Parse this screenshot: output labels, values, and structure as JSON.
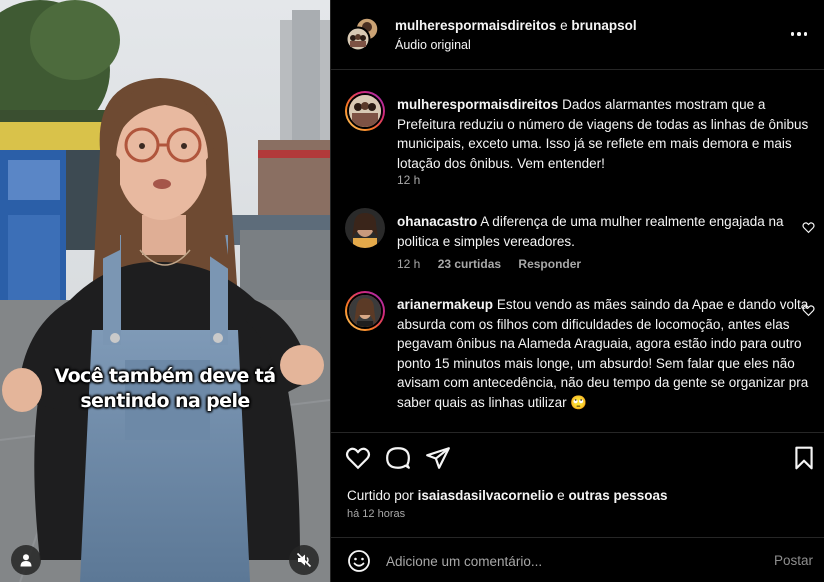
{
  "video": {
    "overlay_lines": [
      "Você também deve tá",
      "sentindo na pele"
    ],
    "icons": {
      "user": "user-icon",
      "mute": "muted-speaker-icon"
    }
  },
  "header": {
    "user1": "mulherespormaisdireitos",
    "conjunction": "e",
    "user2": "brunapsol",
    "audio": "Áudio original"
  },
  "caption": {
    "username": "mulherespormaisdireitos",
    "text": "Dados alarmantes mostram que a Prefeitura reduziu o número de viagens de todas as linhas de ônibus municipais, exceto uma. Isso já se reflete em mais demora e mais lotação dos ônibus. Vem entender!",
    "time": "12 h"
  },
  "comments": [
    {
      "username": "ohanacastro",
      "text": "A diferença de uma mulher realmente engajada na politica e simples vereadores.",
      "time": "12 h",
      "likes": "23 curtidas",
      "reply": "Responder"
    },
    {
      "username": "arianermakeup",
      "text": "Estou vendo as mães saindo da Apae e dando volta absurda com os filhos com dificuldades de locomoção, antes elas pegavam ônibus na Alameda Araguaia, agora estão indo para outro ponto 15 minutos mais longe, um absurdo! Sem falar que eles não avisam com antecedência, não deu tempo da gente se organizar pra saber quais as linhas utilizar",
      "emoji": "🙄"
    }
  ],
  "actions": {
    "liked_prefix": "Curtido por",
    "liked_user": "isaiasdasilvacornelio",
    "liked_and": "e",
    "liked_others": "outras pessoas",
    "timestamp": "há 12 horas"
  },
  "add_comment": {
    "placeholder": "Adicione um comentário...",
    "post_label": "Postar"
  }
}
